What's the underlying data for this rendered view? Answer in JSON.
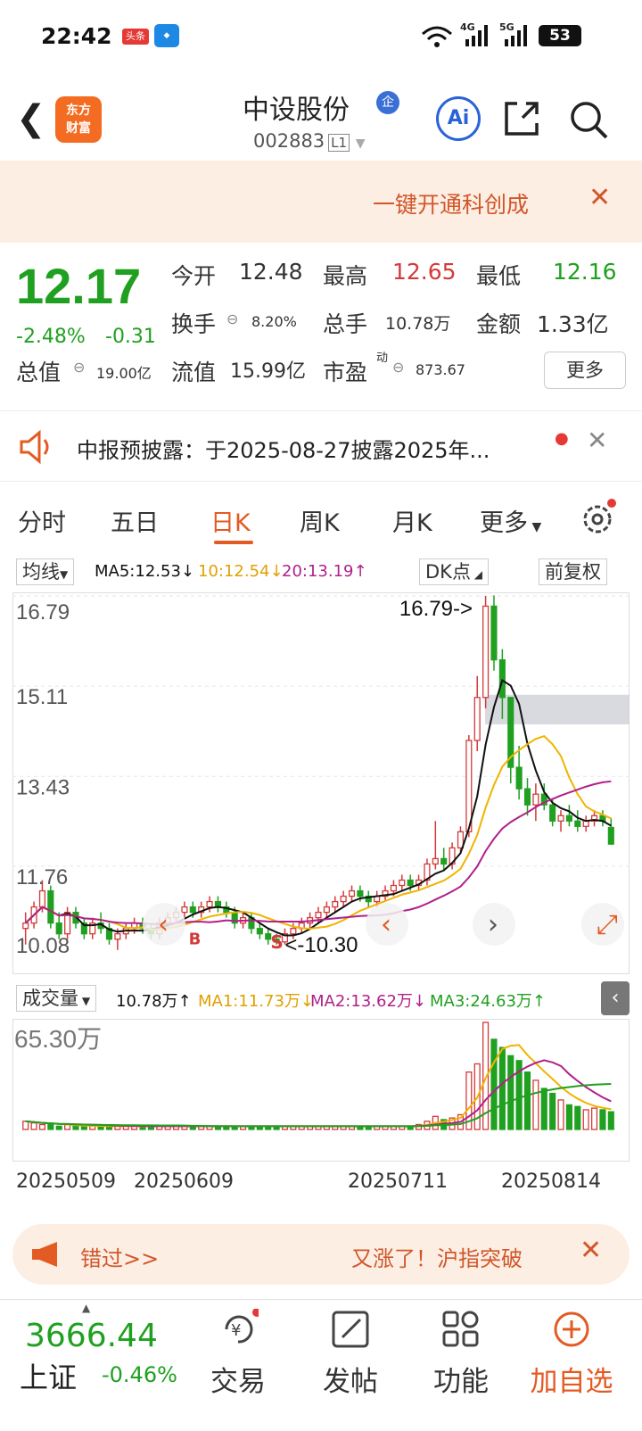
{
  "status": {
    "time": "22:42",
    "badge": "头条",
    "net1": "4G",
    "net2": "5G",
    "battery": "53"
  },
  "header": {
    "name": "中设股份",
    "tag": "企",
    "code": "002883",
    "market": "L1",
    "ai": "Ai"
  },
  "banner": {
    "text": "一键开通科创成"
  },
  "quote": {
    "price": "12.17",
    "chg_pct": "-2.48%",
    "chg": "-0.31",
    "open_l": "今开",
    "open": "12.48",
    "high_l": "最高",
    "high": "12.65",
    "low_l": "最低",
    "low": "12.16",
    "turn_l": "换手",
    "turn": "8.20%",
    "vol_l": "总手",
    "vol": "10.78万",
    "amt_l": "金额",
    "amt": "1.33亿",
    "mcap_l": "总值",
    "mcap": "19.00亿",
    "float_l": "流值",
    "float": "15.99亿",
    "pe_l": "市盈",
    "pe_sup": "动",
    "pe": "873.67",
    "more": "更多"
  },
  "notice": {
    "text": "中报预披露：于2025-08-27披露2025年..."
  },
  "tabs": [
    {
      "label": "分时"
    },
    {
      "label": "五日"
    },
    {
      "label": "日K"
    },
    {
      "label": "周K"
    },
    {
      "label": "月K"
    },
    {
      "label": "更多"
    }
  ],
  "chartbar": {
    "ma_sel": "均线",
    "ma5": "MA5:12.53↓",
    "ma10": "10:12.54↓",
    "ma20": "20:13.19↑",
    "dk": "DK点",
    "fq": "前复权"
  },
  "kaxis": {
    "y1": "16.79",
    "y2": "15.11",
    "y3": "13.43",
    "y4": "11.76",
    "y5": "10.08",
    "hi": "16.79->",
    "lo": "<-10.30",
    "b": "B",
    "s": "S"
  },
  "volbar": {
    "sel": "成交量",
    "v": "10.78万↑",
    "ma1": "MA1:11.73万↓",
    "ma2": "MA2:13.62万↓",
    "ma3": "MA3:24.63万↑",
    "vmax": "65.30万"
  },
  "dates": [
    "20250509",
    "20250609",
    "20250711",
    "20250814"
  ],
  "ad": {
    "t1": "错过>>",
    "t2": "又涨了！沪指突破"
  },
  "index": {
    "value": "3666.44",
    "name": "上证",
    "chg": "-0.46%"
  },
  "nav": [
    {
      "label": "交易"
    },
    {
      "label": "发帖"
    },
    {
      "label": "功能"
    },
    {
      "label": "加自选"
    }
  ],
  "colors": {
    "up": "#d33a3a",
    "down": "#20a020",
    "accent": "#e35a22",
    "ma5": "#111111",
    "ma10": "#f0b400",
    "ma20": "#b0208a"
  },
  "chart_data": {
    "type": "candlestick",
    "ylim": [
      10.08,
      16.79
    ],
    "candles": [
      [
        10.6,
        10.9,
        10.3,
        10.7
      ],
      [
        10.7,
        11.1,
        10.6,
        11.0
      ],
      [
        11.0,
        11.5,
        10.9,
        11.3
      ],
      [
        11.3,
        11.4,
        10.6,
        10.7
      ],
      [
        10.7,
        10.9,
        10.4,
        10.5
      ],
      [
        10.5,
        11.0,
        10.4,
        10.9
      ],
      [
        10.9,
        11.0,
        10.6,
        10.7
      ],
      [
        10.7,
        10.8,
        10.4,
        10.5
      ],
      [
        10.5,
        10.8,
        10.4,
        10.7
      ],
      [
        10.7,
        10.9,
        10.5,
        10.6
      ],
      [
        10.6,
        10.7,
        10.3,
        10.4
      ],
      [
        10.4,
        10.6,
        10.2,
        10.5
      ],
      [
        10.5,
        10.7,
        10.4,
        10.6
      ],
      [
        10.6,
        10.8,
        10.5,
        10.7
      ],
      [
        10.7,
        10.8,
        10.5,
        10.6
      ],
      [
        10.6,
        10.7,
        10.4,
        10.5
      ],
      [
        10.5,
        10.8,
        10.4,
        10.7
      ],
      [
        10.7,
        10.9,
        10.6,
        10.8
      ],
      [
        10.8,
        11.0,
        10.7,
        10.9
      ],
      [
        10.9,
        11.1,
        10.8,
        11.0
      ],
      [
        11.0,
        11.1,
        10.8,
        10.9
      ],
      [
        10.9,
        11.1,
        10.8,
        11.0
      ],
      [
        11.0,
        11.2,
        10.9,
        11.1
      ],
      [
        11.1,
        11.2,
        10.9,
        11.0
      ],
      [
        11.0,
        11.1,
        10.8,
        10.9
      ],
      [
        10.9,
        11.0,
        10.6,
        10.7
      ],
      [
        10.7,
        10.9,
        10.6,
        10.8
      ],
      [
        10.8,
        10.9,
        10.5,
        10.6
      ],
      [
        10.6,
        10.7,
        10.4,
        10.5
      ],
      [
        10.5,
        10.6,
        10.3,
        10.4
      ],
      [
        10.4,
        10.5,
        10.3,
        10.35
      ],
      [
        10.35,
        10.6,
        10.3,
        10.5
      ],
      [
        10.5,
        10.7,
        10.4,
        10.6
      ],
      [
        10.6,
        10.8,
        10.5,
        10.7
      ],
      [
        10.7,
        10.9,
        10.6,
        10.8
      ],
      [
        10.8,
        11.0,
        10.7,
        10.9
      ],
      [
        10.9,
        11.1,
        10.8,
        11.0
      ],
      [
        11.0,
        11.2,
        10.9,
        11.1
      ],
      [
        11.1,
        11.3,
        11.0,
        11.2
      ],
      [
        11.2,
        11.4,
        11.1,
        11.3
      ],
      [
        11.3,
        11.4,
        11.1,
        11.2
      ],
      [
        11.2,
        11.3,
        11.0,
        11.1
      ],
      [
        11.1,
        11.3,
        11.0,
        11.2
      ],
      [
        11.2,
        11.4,
        11.1,
        11.3
      ],
      [
        11.3,
        11.5,
        11.2,
        11.4
      ],
      [
        11.4,
        11.6,
        11.3,
        11.5
      ],
      [
        11.5,
        11.6,
        11.3,
        11.4
      ],
      [
        11.4,
        11.6,
        11.3,
        11.5
      ],
      [
        11.5,
        11.9,
        11.4,
        11.8
      ],
      [
        11.8,
        12.6,
        11.7,
        11.9
      ],
      [
        11.9,
        12.1,
        11.7,
        11.8
      ],
      [
        11.8,
        12.2,
        11.7,
        12.1
      ],
      [
        12.1,
        12.5,
        12.0,
        12.4
      ],
      [
        12.4,
        14.2,
        12.3,
        14.1
      ],
      [
        14.1,
        15.3,
        13.9,
        14.9
      ],
      [
        14.9,
        16.79,
        14.7,
        16.6
      ],
      [
        16.6,
        16.8,
        15.4,
        15.6
      ],
      [
        15.6,
        15.8,
        14.5,
        14.9
      ],
      [
        14.9,
        14.9,
        13.3,
        13.6
      ],
      [
        13.6,
        14.0,
        13.0,
        13.2
      ],
      [
        13.2,
        13.4,
        12.7,
        12.9
      ],
      [
        12.9,
        13.3,
        12.6,
        13.1
      ],
      [
        13.1,
        13.3,
        12.8,
        12.9
      ],
      [
        12.9,
        13.0,
        12.5,
        12.6
      ],
      [
        12.6,
        12.8,
        12.4,
        12.7
      ],
      [
        12.7,
        12.9,
        12.5,
        12.6
      ],
      [
        12.6,
        12.8,
        12.4,
        12.5
      ],
      [
        12.5,
        12.7,
        12.4,
        12.6
      ],
      [
        12.6,
        12.8,
        12.5,
        12.7
      ],
      [
        12.7,
        12.8,
        12.5,
        12.6
      ],
      [
        12.48,
        12.65,
        12.16,
        12.17
      ]
    ],
    "vol_max": 65.3,
    "volumes": [
      5,
      4,
      3,
      3,
      2,
      3,
      2,
      2,
      2,
      2,
      2,
      2,
      2,
      2,
      2,
      2,
      2,
      2,
      2,
      2,
      2,
      2,
      2,
      2,
      2,
      2,
      2,
      2,
      2,
      2,
      2,
      2,
      2,
      2,
      2,
      2,
      2,
      2,
      2,
      2,
      2,
      2,
      2,
      2,
      2,
      2,
      2,
      3,
      5,
      8,
      6,
      7,
      9,
      35,
      40,
      65.3,
      55,
      50,
      45,
      42,
      35,
      30,
      25,
      22,
      18,
      15,
      14,
      12,
      13,
      12,
      10.78
    ]
  }
}
